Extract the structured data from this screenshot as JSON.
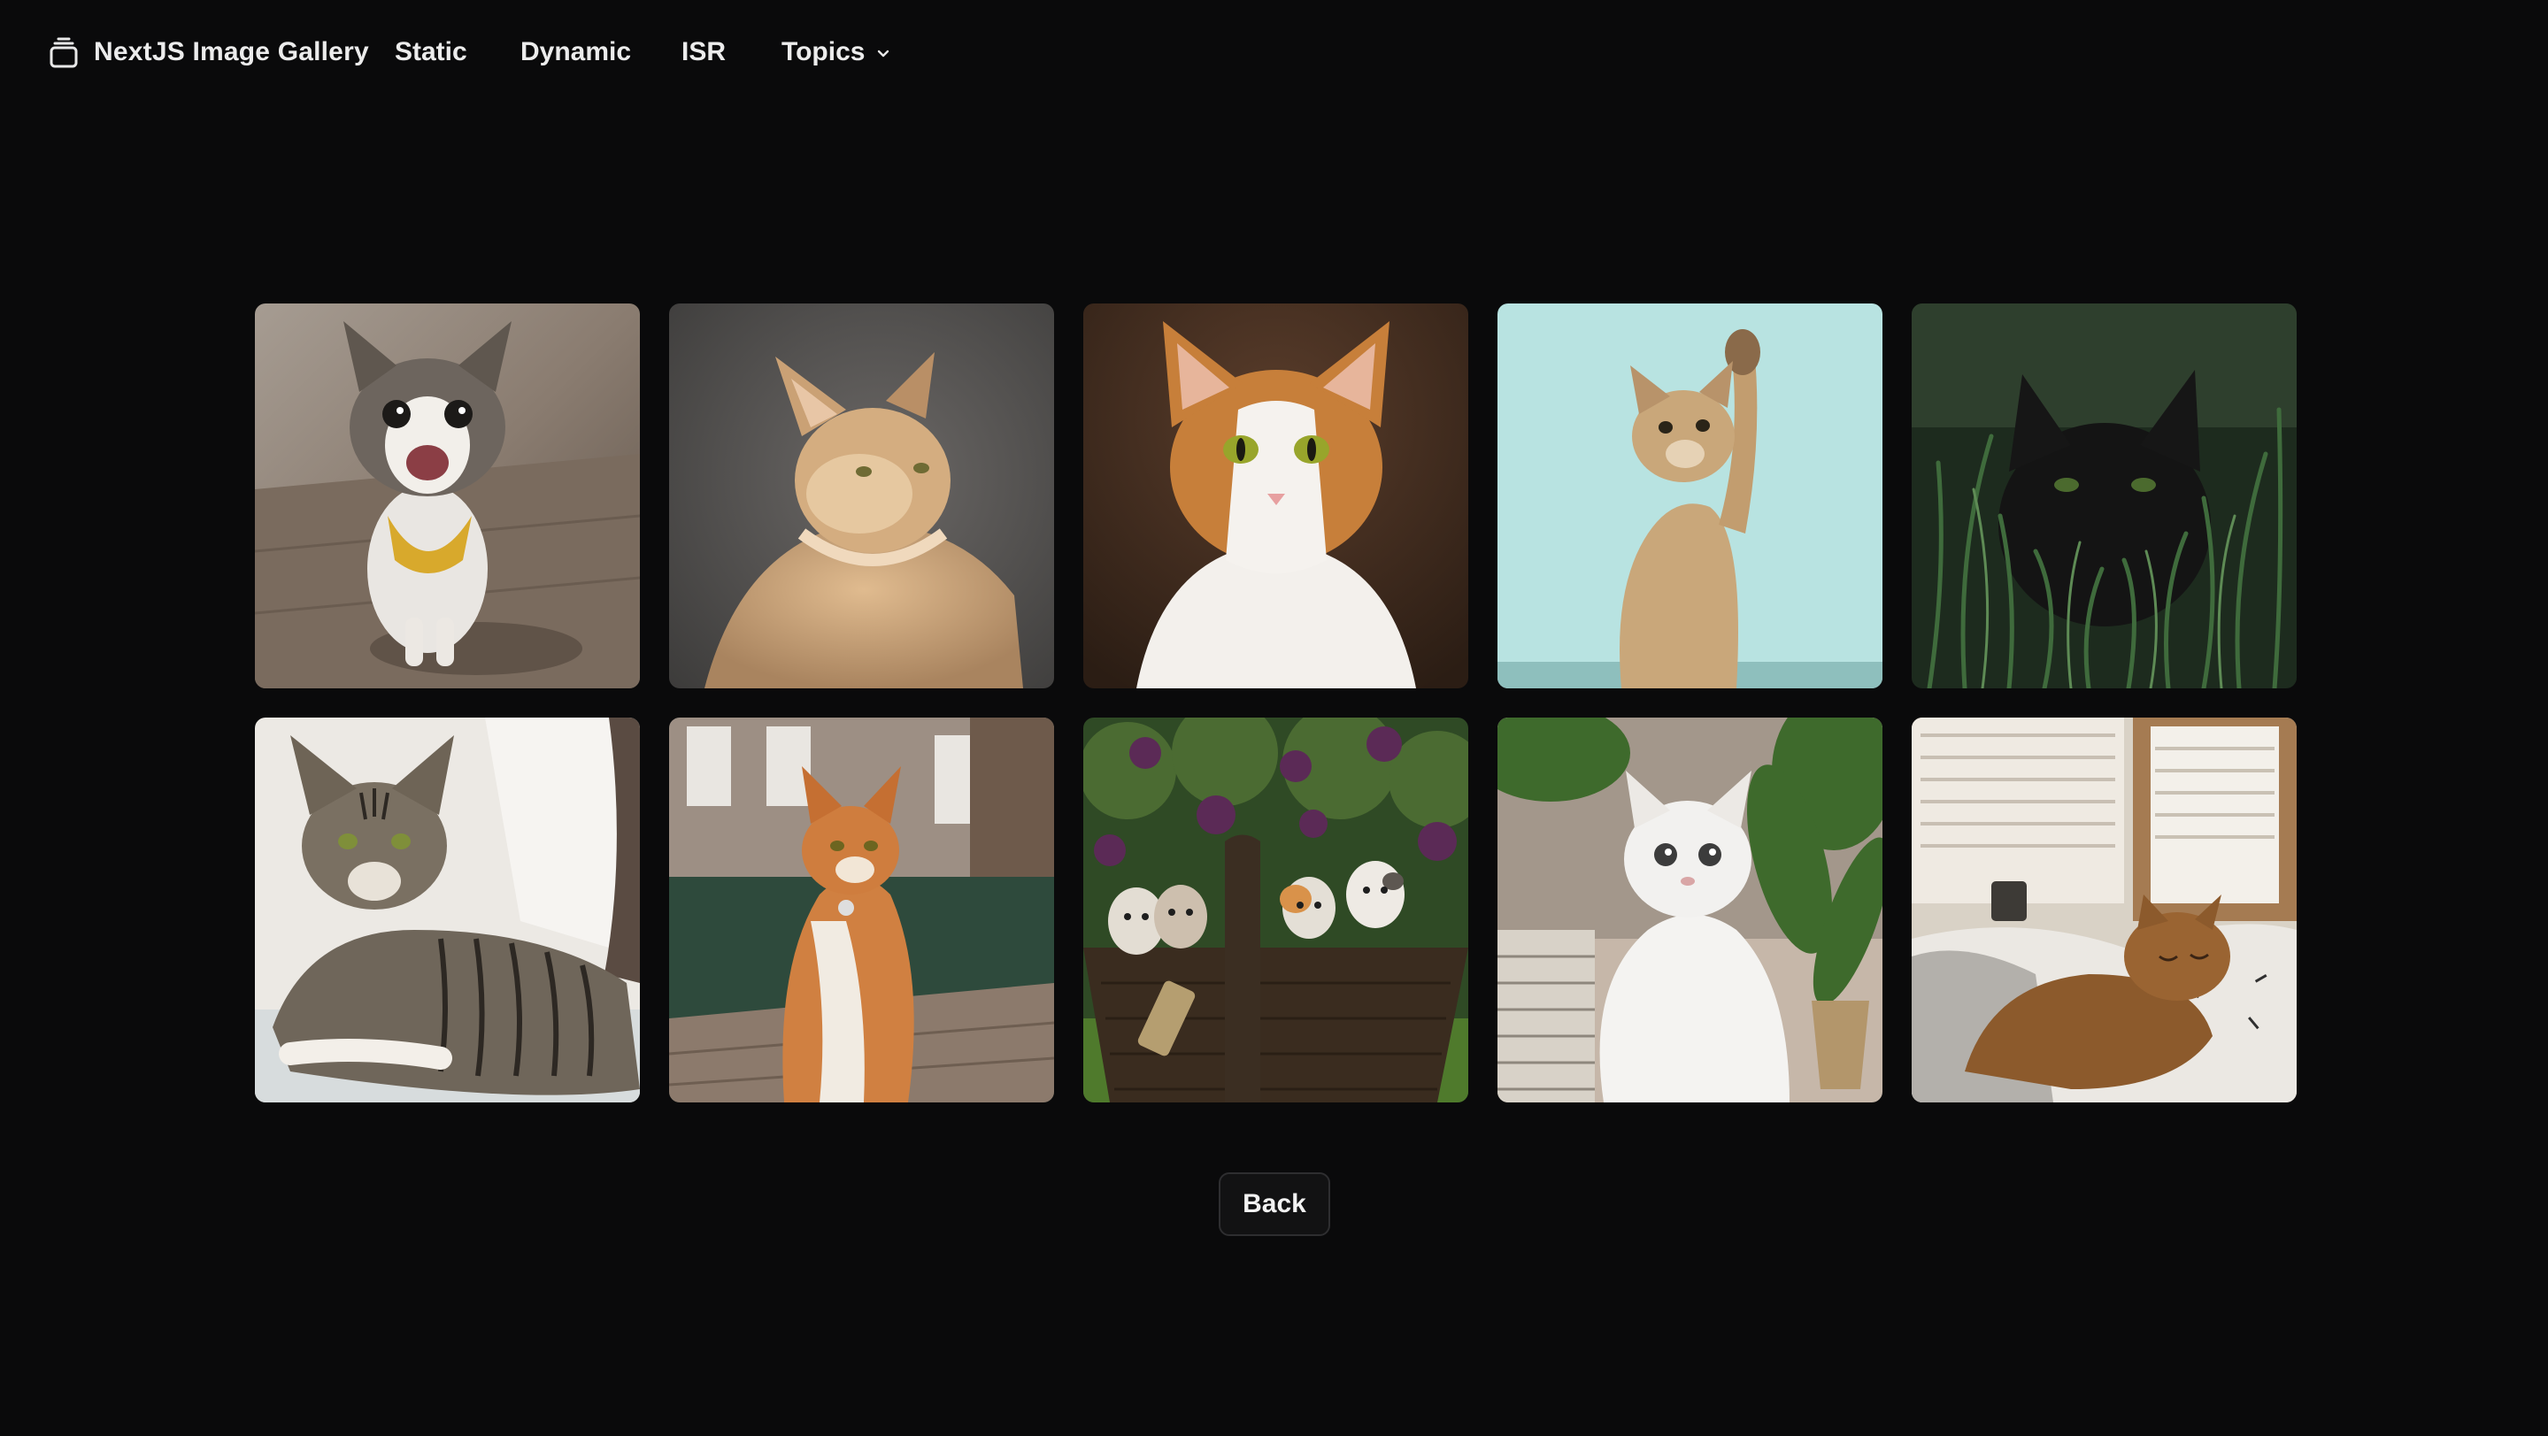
{
  "navbar": {
    "brand": {
      "label": "NextJS Image Gallery",
      "icon": "stack-icon"
    },
    "links": [
      {
        "label": "Static"
      },
      {
        "label": "Dynamic"
      },
      {
        "label": "ISR"
      },
      {
        "label": "Topics",
        "icon": "chevron-down-icon"
      }
    ]
  },
  "gallery": {
    "images": [
      {
        "subject": "meowing tabby-and-white cat with yellow bandana"
      },
      {
        "subject": "fluffy ginger long-haired cat in profile"
      },
      {
        "subject": "orange and white cat facing camera"
      },
      {
        "subject": "golden kitten raising paw on mint background"
      },
      {
        "subject": "black cat hidden in tall grass"
      },
      {
        "subject": "tabby cat lying on white blanket"
      },
      {
        "subject": "ginger cat sitting on brick path by canal"
      },
      {
        "subject": "four kittens in a wicker basket under lilacs"
      },
      {
        "subject": "white fluffy kitten next to potted plants"
      },
      {
        "subject": "ginger cat sleeping on bed by window"
      }
    ]
  },
  "actions": {
    "back_label": "Back"
  }
}
